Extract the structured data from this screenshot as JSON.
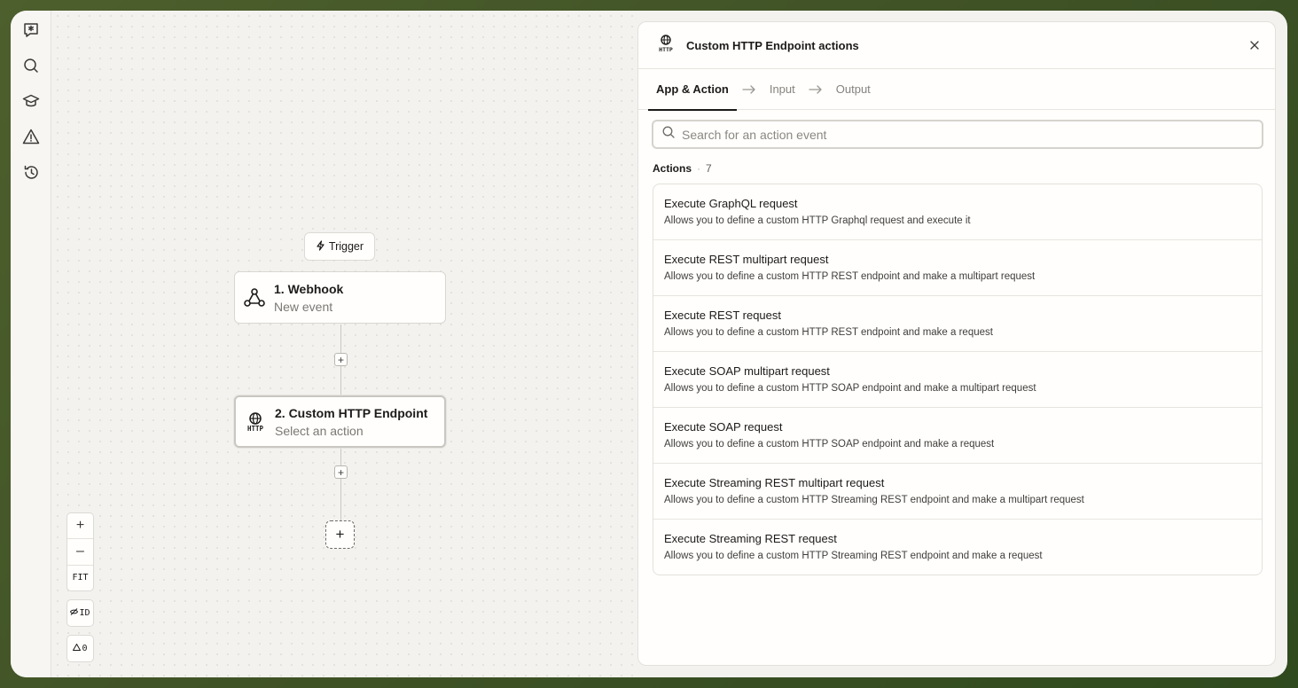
{
  "canvas": {
    "trigger_label": "Trigger",
    "nodes": [
      {
        "title": "1. Webhook",
        "subtitle": "New event",
        "icon": "webhook-icon"
      },
      {
        "title": "2. Custom HTTP Endpoint",
        "subtitle": "Select an action",
        "icon": "http-globe-icon"
      }
    ],
    "controls": {
      "zoom_in": "+",
      "zoom_out": "–",
      "fit": "FIT",
      "id_toggle": "ID",
      "warnings_count": "0"
    }
  },
  "panel": {
    "title": "Custom HTTP Endpoint actions",
    "icon_text": "HTTP",
    "tabs": [
      {
        "label": "App & Action",
        "active": true
      },
      {
        "label": "Input",
        "active": false
      },
      {
        "label": "Output",
        "active": false
      }
    ],
    "search": {
      "placeholder": "Search for an action event",
      "value": ""
    },
    "actions_label": "Actions",
    "actions_count": "7",
    "actions": [
      {
        "title": "Execute GraphQL request",
        "description": "Allows you to define a custom HTTP Graphql request and execute it"
      },
      {
        "title": "Execute REST multipart request",
        "description": "Allows you to define a custom HTTP REST endpoint and make a multipart request"
      },
      {
        "title": "Execute REST request",
        "description": "Allows you to define a custom HTTP REST endpoint and make a request"
      },
      {
        "title": "Execute SOAP multipart request",
        "description": "Allows you to define a custom HTTP SOAP endpoint and make a multipart request"
      },
      {
        "title": "Execute SOAP request",
        "description": "Allows you to define a custom HTTP SOAP endpoint and make a request"
      },
      {
        "title": "Execute Streaming REST multipart request",
        "description": "Allows you to define a custom HTTP Streaming REST endpoint and make a multipart request"
      },
      {
        "title": "Execute Streaming REST request",
        "description": "Allows you to define a custom HTTP Streaming REST endpoint and make a request"
      }
    ]
  },
  "sidebar": {
    "icons": [
      "assistant-chat-icon",
      "search-icon",
      "learn-graduation-icon",
      "alert-warning-icon",
      "history-icon"
    ]
  },
  "colors": {
    "background": "#3f5226",
    "canvas": "#f3f2ef",
    "panel": "#fffefc",
    "text": "#1c1b1a",
    "muted": "#85837e"
  }
}
